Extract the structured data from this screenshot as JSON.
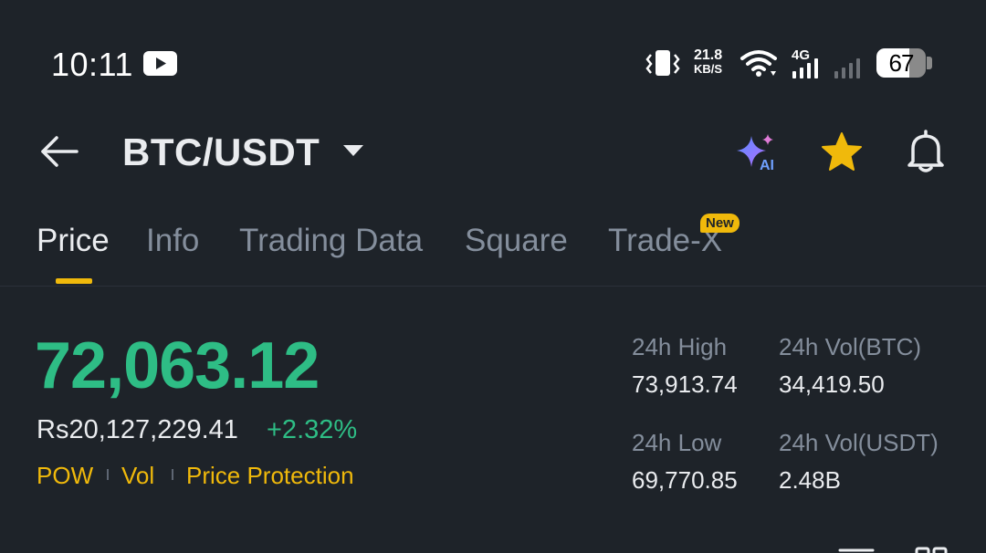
{
  "status_bar": {
    "time": "10:11",
    "net_speed_value": "21.8",
    "net_speed_unit": "KB/S",
    "network_type": "4G",
    "battery_percent": "67",
    "battery_level": 0.67
  },
  "header": {
    "pair": "BTC/USDT",
    "icons": [
      "back-arrow-icon",
      "caret-down-icon",
      "ai-sparkle-icon",
      "star-icon",
      "bell-icon"
    ]
  },
  "tabs": [
    {
      "label": "Price",
      "active": true
    },
    {
      "label": "Info",
      "active": false
    },
    {
      "label": "Trading Data",
      "active": false
    },
    {
      "label": "Square",
      "active": false
    },
    {
      "label": "Trade-X",
      "active": false,
      "badge": "New"
    }
  ],
  "price": {
    "last": "72,063.12",
    "fiat": "Rs20,127,229.41",
    "change": "+2.32%",
    "tags": [
      "POW",
      "Vol",
      "Price Protection"
    ]
  },
  "stats": {
    "high_label": "24h High",
    "high_value": "73,913.74",
    "vol_btc_label": "24h Vol(BTC)",
    "vol_btc_value": "34,419.50",
    "low_label": "24h Low",
    "low_value": "69,770.85",
    "vol_usdt_label": "24h Vol(USDT)",
    "vol_usdt_value": "2.48B"
  },
  "colors": {
    "background": "#1e2329",
    "up_green": "#2ebd85",
    "accent_yellow": "#f0b90b",
    "muted_text": "#848e9c",
    "primary_text": "#eaecef"
  }
}
